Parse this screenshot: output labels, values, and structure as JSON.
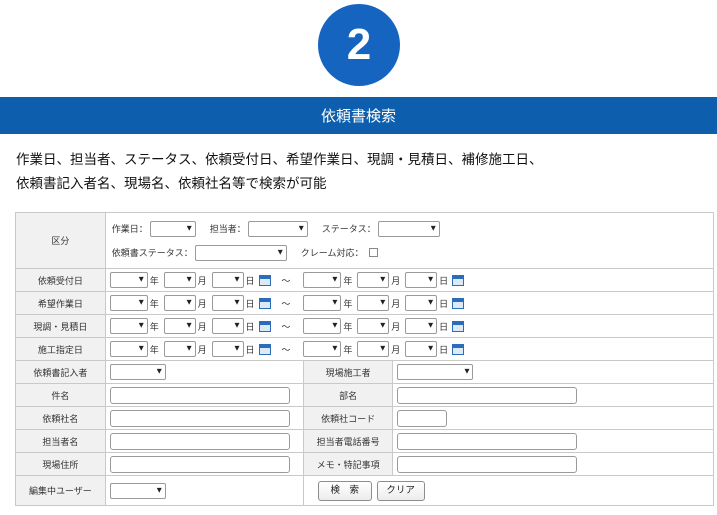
{
  "step_number": "2",
  "banner_title": "依頼書検索",
  "description": [
    "作業日、担当者、ステータス、依頼受付日、希望作業日、現調・見積日、補修施工日、",
    "依頼書記入者名、現場名、依頼社名等で検索が可能"
  ],
  "form": {
    "kubun": {
      "label": "区分",
      "sagyoubi": "作業日：",
      "tantousha": "担当者：",
      "status": "ステータス：",
      "irai_status": "依頼書ステータス：",
      "claim": "クレーム対応："
    },
    "date_rows": [
      {
        "label": "依頼受付日"
      },
      {
        "label": "希望作業日"
      },
      {
        "label": "現調・見積日"
      },
      {
        "label": "施工指定日"
      }
    ],
    "units": {
      "year": "年",
      "month": "月",
      "day": "日",
      "tilde": "～"
    },
    "fields": {
      "kinyusha": "依頼書記入者",
      "genba_sekou": "現場施工者",
      "kenmei": "件名",
      "heyamei": "部名",
      "iraisha": "依頼社名",
      "iraisha_code": "依頼社コード",
      "tantousha_name": "担当者名",
      "tantousha_tel": "担当者電話番号",
      "genba_address": "現場住所",
      "memo": "メモ・特記事項",
      "henshuu_user": "編集中ユーザー"
    },
    "buttons": {
      "search": "検　索",
      "clear": "クリア"
    }
  }
}
